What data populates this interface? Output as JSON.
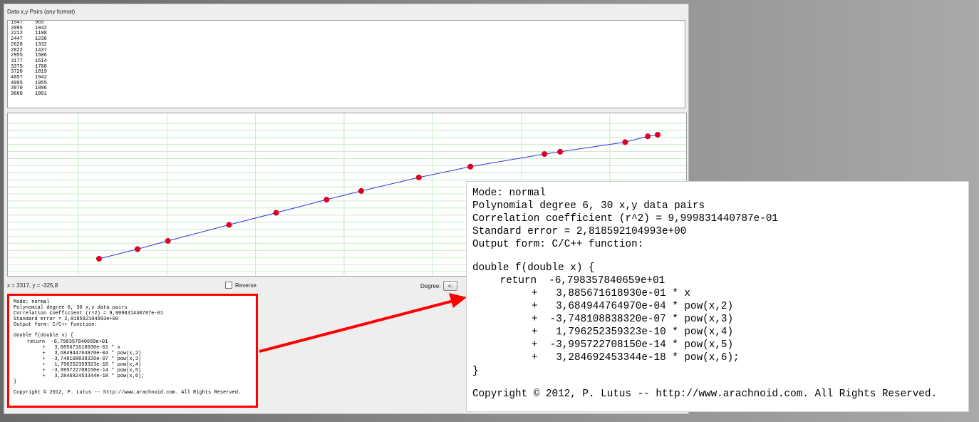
{
  "data_panel": {
    "label": "Data x,y Pairs (any format)",
    "pairs": [
      [
        "1947",
        "965"
      ],
      [
        "2095",
        "1042"
      ],
      [
        "2212",
        "1108"
      ],
      [
        "2447",
        "1236"
      ],
      [
        "2628",
        "1332"
      ],
      [
        "2822",
        "1437"
      ],
      [
        "2955",
        "1506"
      ],
      [
        "3177",
        "1614"
      ],
      [
        "3375",
        "1700"
      ],
      [
        "3720",
        "1819"
      ],
      [
        "4057",
        "1942"
      ],
      [
        "4095",
        "1955"
      ],
      [
        "3970",
        "1896"
      ],
      [
        "3660",
        "1801"
      ]
    ]
  },
  "plot": {
    "curve_color": "#3333dd",
    "point_color": "#dd0022",
    "grid_color": "#c4ecc4"
  },
  "status": {
    "coords": "x = 3317, y = -325,8",
    "reverse_label": "Reverse",
    "degree_label": "Degree:",
    "degree_button": "<-"
  },
  "output": {
    "mode": "Mode: normal",
    "degree": "Polynomial degree 6, 30 x,y data pairs",
    "correlation": "Correlation coefficient (r^2) = 9,999831440787e-01",
    "std_error": "Standard error = 2,818592104993e+00",
    "form": "Output form: C/C++ function:",
    "func_sig": "double f(double x) {",
    "return_line": "return  -6,798357840659e+01",
    "terms": [
      "+   3,885671618930e-01 * x",
      "+   3,684944764970e-04 * pow(x,2)",
      "+  -3,748108838320e-07 * pow(x,3)",
      "+   1,796252359323e-10 * pow(x,4)",
      "+  -3,995722708150e-14 * pow(x,5)",
      "+   3,284692453344e-18 * pow(x,6);"
    ],
    "closing": "}",
    "copyright": "Copyright © 2012, P. Lutus -- http://www.arachnoid.com. All Rights Reserved."
  },
  "colors": {
    "highlight": "#ff0000"
  }
}
